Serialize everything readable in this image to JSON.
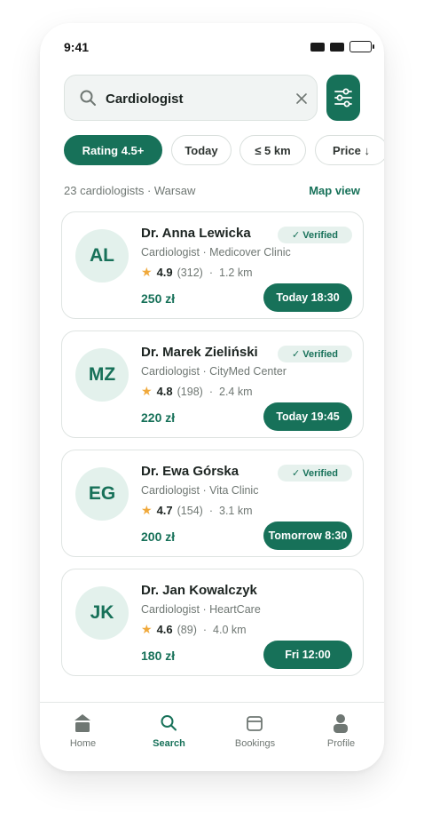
{
  "status_bar": {
    "time": "9:41"
  },
  "search": {
    "value": "Cardiologist",
    "placeholder": ""
  },
  "filters": [
    {
      "label": "Rating 4.5+",
      "active": true
    },
    {
      "label": "Today",
      "active": false
    },
    {
      "label": "≤ 5 km",
      "active": false
    },
    {
      "label": "Price ↓",
      "active": false
    }
  ],
  "results": {
    "summary": "23 cardiologists · Warsaw",
    "map_view": "Map view"
  },
  "doctors": [
    {
      "initials": "AL",
      "name": "Dr. Anna Lewicka",
      "verified": "Verified",
      "specialty": "Cardiologist · Medicover Clinic",
      "rating": "4.9",
      "reviews": "(312)",
      "distance": "1.2 km",
      "price": "250 zł",
      "slot": "Today 18:30"
    },
    {
      "initials": "MZ",
      "name": "Dr. Marek Zieliński",
      "verified": "Verified",
      "specialty": "Cardiologist · CityMed Center",
      "rating": "4.8",
      "reviews": "(198)",
      "distance": "2.4 km",
      "price": "220 zł",
      "slot": "Today 19:45"
    },
    {
      "initials": "EG",
      "name": "Dr. Ewa Górska",
      "verified": "Verified",
      "specialty": "Cardiologist · Vita Clinic",
      "rating": "4.7",
      "reviews": "(154)",
      "distance": "3.1 km",
      "price": "200 zł",
      "slot": "Tomorrow 8:30"
    },
    {
      "initials": "JK",
      "name": "Dr. Jan Kowalczyk",
      "verified": "",
      "specialty": "Cardiologist · HeartCare",
      "rating": "4.6",
      "reviews": "(89)",
      "distance": "4.0 km",
      "price": "180 zł",
      "slot": "Fri 12:00"
    }
  ],
  "tabs": [
    {
      "label": "Home",
      "icon": "home-icon",
      "active": false
    },
    {
      "label": "Search",
      "icon": "search-icon",
      "active": true
    },
    {
      "label": "Bookings",
      "icon": "calendar-icon",
      "active": false
    },
    {
      "label": "Profile",
      "icon": "user-icon",
      "active": false
    }
  ],
  "colors": {
    "brand": "#177159",
    "star": "#f0a93b",
    "avatar_bg": "#e3f1ec"
  }
}
